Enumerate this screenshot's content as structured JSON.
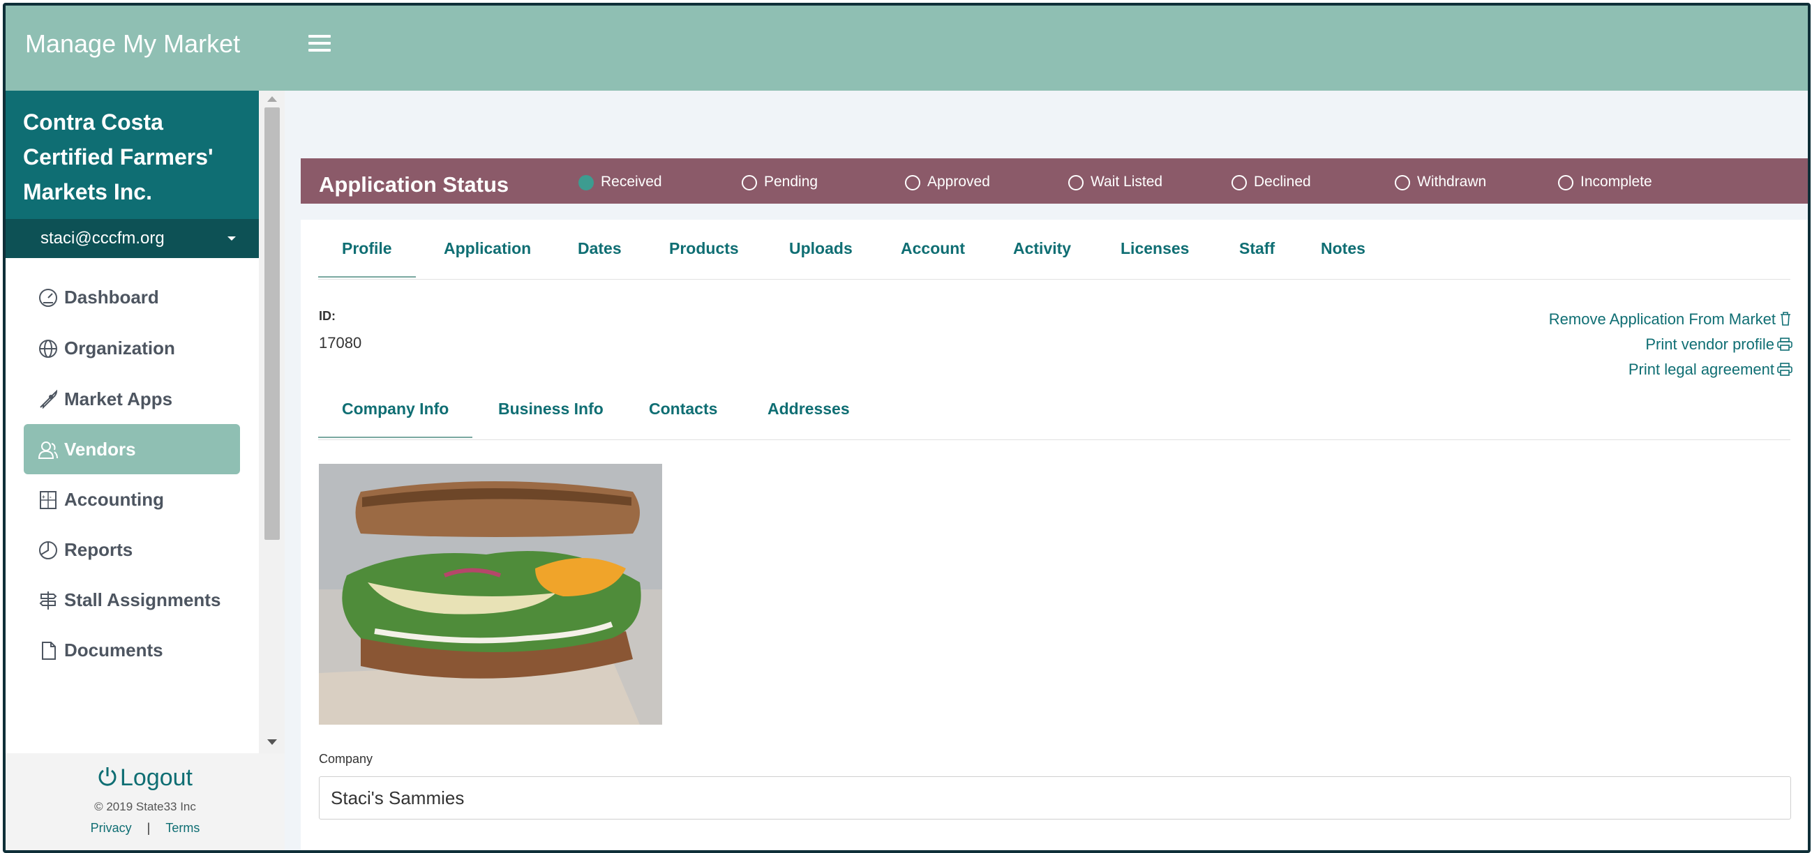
{
  "header": {
    "app_title": "Manage My Market"
  },
  "sidebar": {
    "org_name": [
      "Contra Costa",
      "Certified Farmers'",
      "Markets Inc."
    ],
    "user_email": "staci@cccfm.org",
    "items": [
      {
        "label": "Dashboard",
        "icon": "gauge-icon"
      },
      {
        "label": "Organization",
        "icon": "globe-icon"
      },
      {
        "label": "Market Apps",
        "icon": "rocket-icon"
      },
      {
        "label": "Vendors",
        "icon": "users-icon",
        "active": true
      },
      {
        "label": "Accounting",
        "icon": "calculator-icon"
      },
      {
        "label": "Reports",
        "icon": "pie-chart-icon"
      },
      {
        "label": "Stall Assignments",
        "icon": "signpost-icon"
      },
      {
        "label": "Documents",
        "icon": "document-icon"
      }
    ],
    "footer": {
      "logout": "Logout",
      "copyright": "© 2019 State33 Inc",
      "privacy": "Privacy",
      "terms": "Terms"
    }
  },
  "status": {
    "title": "Application Status",
    "options": [
      "Received",
      "Pending",
      "Approved",
      "Wait Listed",
      "Declined",
      "Withdrawn",
      "Incomplete"
    ],
    "selected": "Received"
  },
  "tabs": [
    "Profile",
    "Application",
    "Dates",
    "Products",
    "Uploads",
    "Account",
    "Activity",
    "Licenses",
    "Staff",
    "Notes"
  ],
  "active_tab": "Profile",
  "profile": {
    "id_label": "ID:",
    "id_value": "17080",
    "actions": [
      "Remove Application From Market",
      "Print vendor profile",
      "Print legal agreement"
    ],
    "subtabs": [
      "Company Info",
      "Business Info",
      "Contacts",
      "Addresses"
    ],
    "active_subtab": "Company Info",
    "company_label": "Company",
    "company_value": "Staci's Sammies"
  },
  "colors": {
    "topbar": "#8fbfb3",
    "org": "#0f6e73",
    "status_bar": "#8b5a69",
    "accent": "#0f6e73"
  }
}
